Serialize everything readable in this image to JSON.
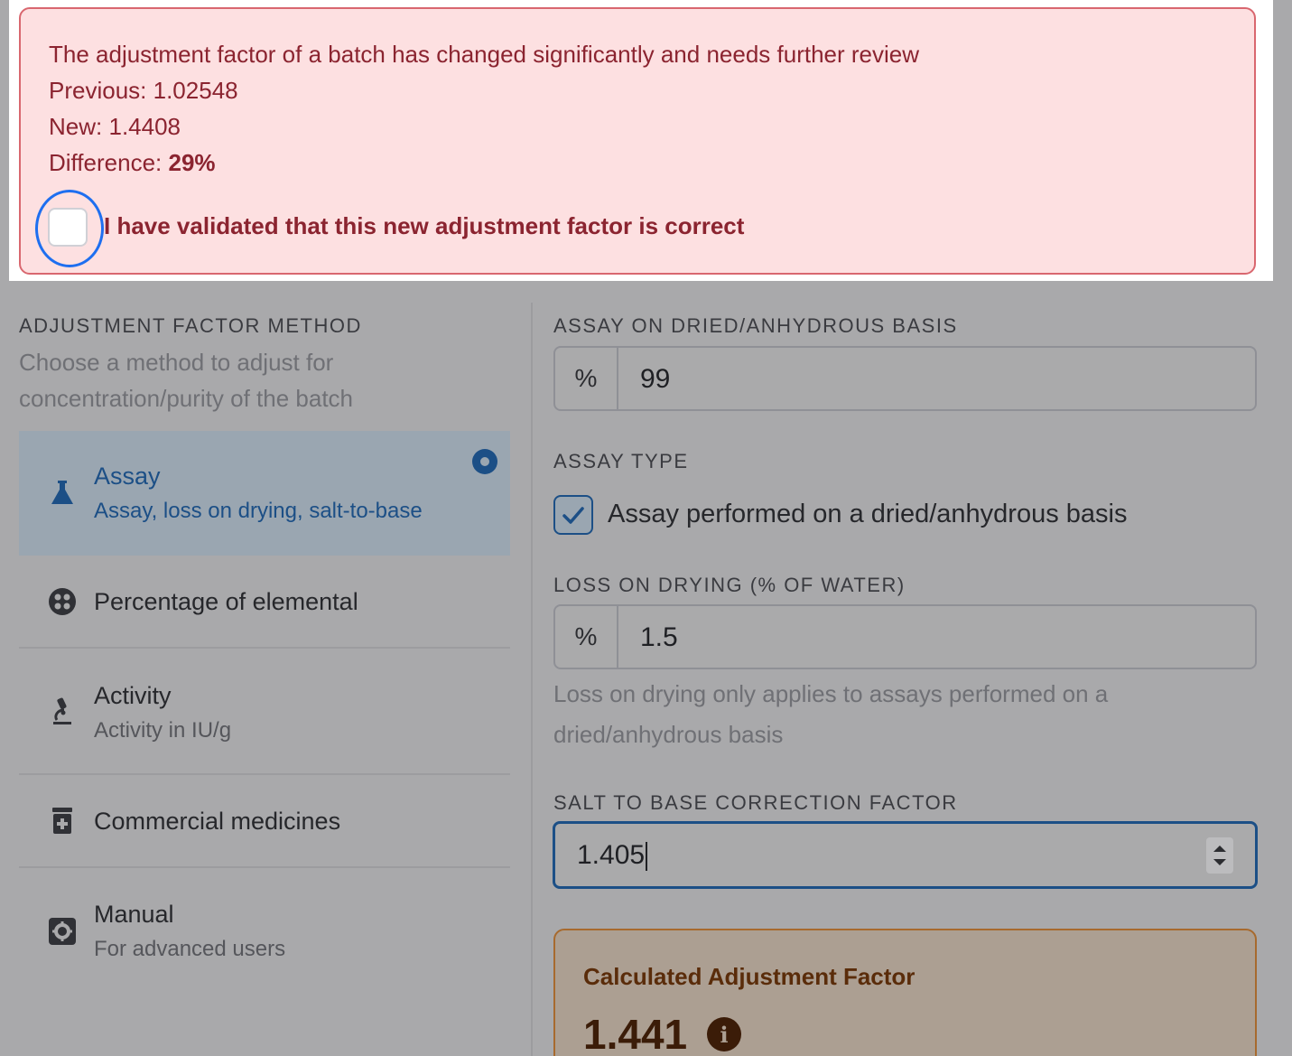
{
  "alert": {
    "message": "The adjustment factor of a batch has changed significantly and needs further review",
    "previous_label": "Previous:",
    "previous_value": "1.02548",
    "new_label": "New:",
    "new_value": "1.4408",
    "difference_label": "Difference:",
    "difference_value": "29%",
    "confirm_label": "I have validated that this new adjustment factor is correct",
    "confirm_checked": false
  },
  "method_section": {
    "title": "ADJUSTMENT FACTOR METHOD",
    "subtitle": "Choose a method to adjust for concentration/purity of the batch",
    "methods": [
      {
        "name": "Assay",
        "desc": "Assay, loss on drying, salt-to-base",
        "icon": "flask-icon",
        "selected": true
      },
      {
        "name": "Percentage of elemental",
        "desc": "",
        "icon": "atom-icon",
        "selected": false
      },
      {
        "name": "Activity",
        "desc": "Activity in IU/g",
        "icon": "microscope-icon",
        "selected": false
      },
      {
        "name": "Commercial medicines",
        "desc": "",
        "icon": "medicine-bottle-icon",
        "selected": false
      },
      {
        "name": "Manual",
        "desc": "For advanced users",
        "icon": "cog-icon",
        "selected": false
      }
    ]
  },
  "form": {
    "assay_label": "ASSAY ON DRIED/ANHYDROUS BASIS",
    "assay_prefix": "%",
    "assay_value": "99",
    "assay_type_label": "ASSAY TYPE",
    "assay_type_checkbox": "Assay performed on a dried/anhydrous basis",
    "assay_type_checked": true,
    "lod_label": "LOSS ON DRYING (% OF WATER)",
    "lod_prefix": "%",
    "lod_value": "1.5",
    "lod_help": "Loss on drying only applies to assays performed on a dried/anhydrous basis",
    "salt_label": "SALT TO BASE CORRECTION FACTOR",
    "salt_value": "1.405"
  },
  "result": {
    "title": "Calculated Adjustment Factor",
    "value": "1.441"
  },
  "colors": {
    "alert_bg": "#fde0e1",
    "alert_text": "#8b2430",
    "focus_ring": "#1e6ff0",
    "primary": "#1c4f86",
    "result_text": "#3b1c08"
  }
}
